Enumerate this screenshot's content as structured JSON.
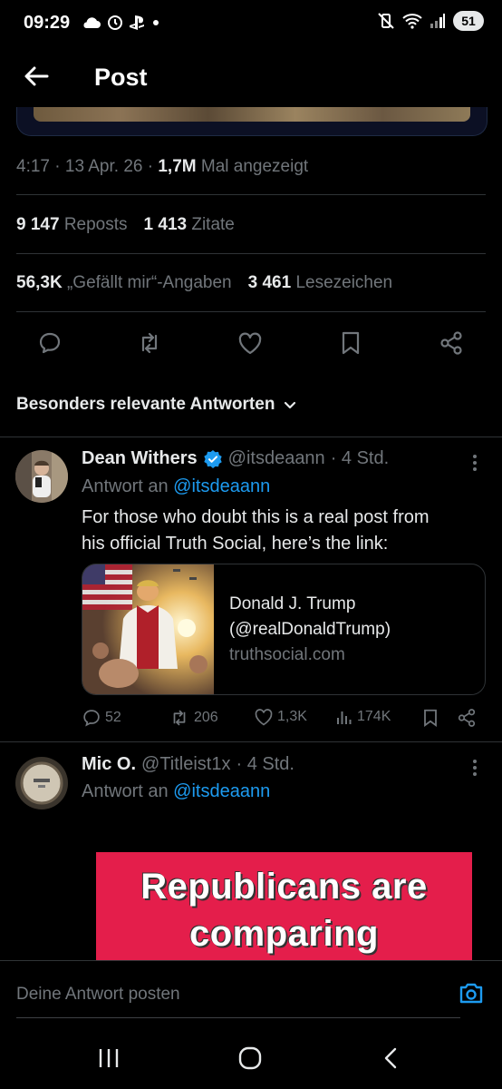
{
  "status_bar": {
    "time": "09:29",
    "battery": "51",
    "left_icons": [
      "cloud-icon",
      "wristwatch-icon",
      "playstation-icon",
      "dot-icon"
    ],
    "right_icons": [
      "mute-vibrate-icon",
      "wifi-icon",
      "signal-icon",
      "battery-icon"
    ]
  },
  "header": {
    "title": "Post",
    "back_icon": "arrow-left-icon"
  },
  "post_meta": {
    "time": "4:17",
    "date": "13 Apr. 26",
    "views_count": "1,7M",
    "views_label": "Mal angezeigt"
  },
  "stats": {
    "reposts_count": "9 147",
    "reposts_label": "Reposts",
    "quotes_count": "1 413",
    "quotes_label": "Zitate",
    "likes_count": "56,3K",
    "likes_label": "„Gefällt mir“-Angaben",
    "bookmarks_count": "3 461",
    "bookmarks_label": "Lesezeichen"
  },
  "actions": [
    "reply-icon",
    "repost-icon",
    "like-icon",
    "bookmark-icon",
    "share-icon"
  ],
  "sort": {
    "label": "Besonders relevante Antworten"
  },
  "replies": [
    {
      "name": "Dean Withers",
      "verified": true,
      "handle": "@itsdeaann",
      "time": "· 4 Std.",
      "reply_to_prefix": "Antwort an",
      "reply_to_handle": "@itsdeaann",
      "text_line1": "For those who doubt this is a real post from",
      "text_line2": "his official Truth Social, here’s the link:",
      "card": {
        "title": "Donald J. Trump",
        "subtitle": "(@realDonaldTrump)",
        "domain": "truthsocial.com"
      },
      "metrics": {
        "replies": "52",
        "reposts": "206",
        "likes": "1,3K",
        "views": "174K"
      }
    },
    {
      "name": "Mic O.",
      "handle": "@Titleist1x",
      "time": "· 4 Std.",
      "reply_to_prefix": "Antwort an",
      "reply_to_handle": "@itsdeaann",
      "image_text_line1": "Republicans are",
      "image_text_line2": "comparing"
    }
  ],
  "composer": {
    "placeholder": "Deine Antwort posten"
  },
  "colors": {
    "accent": "#1d9bf0",
    "background": "#000000",
    "muted": "#71767b",
    "meme_red": "#e41e4b"
  }
}
